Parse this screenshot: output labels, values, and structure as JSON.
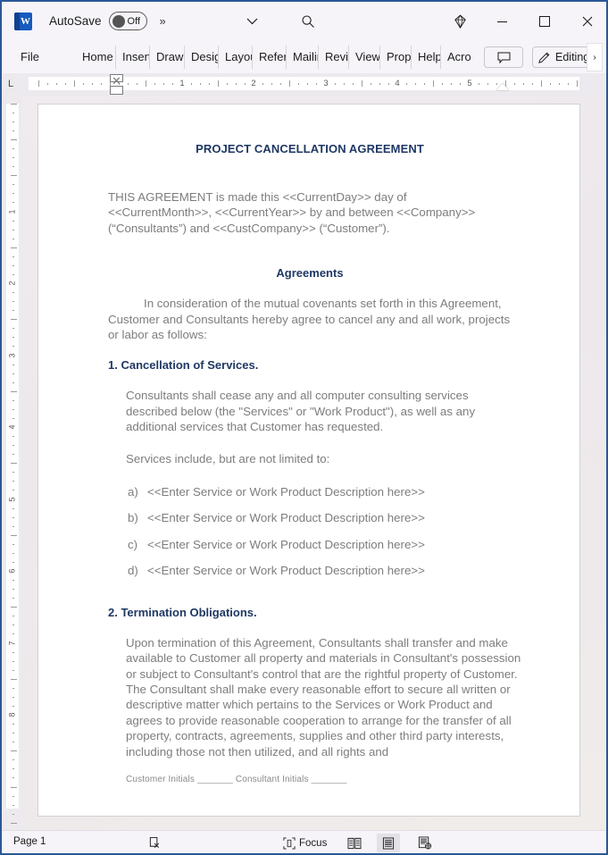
{
  "app": {
    "name": "Microsoft Word",
    "logo_text": "W",
    "accent_color": "#185abd",
    "window_border_color": "#2b5797"
  },
  "titlebar": {
    "autosave_label": "AutoSave",
    "autosave_state": "Off",
    "overflow_chevrons": "»",
    "caret_icon": "chevron-down-icon",
    "search_icon": "search-icon",
    "copilot_icon": "diamond-icon",
    "minimize_label": "–",
    "maximize_label": "□",
    "close_label": "✕"
  },
  "ribbon": {
    "tabs": [
      {
        "label": "File",
        "key": "file"
      },
      {
        "label": "Home",
        "key": "home"
      },
      {
        "label": "Insert",
        "key": "insert"
      },
      {
        "label": "Draw",
        "key": "draw"
      },
      {
        "label": "Design",
        "key": "design"
      },
      {
        "label": "Layout",
        "key": "layout"
      },
      {
        "label": "References",
        "key": "references"
      },
      {
        "label": "Mailings",
        "key": "mailings"
      },
      {
        "label": "Review",
        "key": "review"
      },
      {
        "label": "View",
        "key": "view"
      },
      {
        "label": "Properties",
        "key": "properties"
      },
      {
        "label": "Help",
        "key": "help"
      },
      {
        "label": "Acrobat",
        "key": "acrobat"
      }
    ],
    "comment_icon": "comment-icon",
    "editing_label": "Editing",
    "editing_icon": "pencil-icon",
    "more_label": "›"
  },
  "ruler": {
    "tab_stop_marker": "L",
    "horizontal_numbers": [
      "1",
      "2",
      "3",
      "4",
      "5"
    ],
    "vertical_numbers": [
      "1",
      "2",
      "3",
      "4",
      "5",
      "6",
      "7",
      "8"
    ],
    "first_line_indent_icon": "first-line-indent-marker",
    "hanging_indent_icon": "hanging-indent-marker",
    "right_indent_icon": "right-indent-marker"
  },
  "document": {
    "title": "PROJECT CANCELLATION AGREEMENT",
    "intro": "THIS AGREEMENT is made this <<CurrentDay>> day of <<CurrentMonth>>, <<CurrentYear>> by and between <<Company>> (“Consultants”) and <<CustCompany>> (“Customer”).",
    "agreements_heading": "Agreements",
    "consideration": "In consideration of the mutual covenants set forth in this Agreement, Customer and Consultants hereby agree to cancel any and all work, projects or labor as follows:",
    "section1_heading": "1. Cancellation of Services.",
    "section1_p1": "Consultants shall cease any and all computer consulting services described below (the \"Services\" or \"Work Product\"), as well as any additional services that Customer has requested.",
    "section1_p2": "Services include, but are not limited to:",
    "service_items": [
      {
        "marker": "a)",
        "text": "<<Enter Service or Work Product Description here>>"
      },
      {
        "marker": "b)",
        "text": "<<Enter Service or Work Product Description here>>"
      },
      {
        "marker": "c)",
        "text": "<<Enter Service or Work Product Description here>>"
      },
      {
        "marker": "d)",
        "text": "<<Enter Service or Work Product Description here>>"
      }
    ],
    "section2_heading": "2. Termination Obligations.",
    "section2_p1": "Upon termination of this Agreement, Consultants shall transfer and make available to Customer all property and materials in Consultant's possession or subject to Consultant's control that are the rightful property of Customer.  The Consultant shall make every reasonable effort to secure all written or descriptive matter which pertains to the Services or Work Product and agrees to provide reasonable cooperation to arrange for the transfer of all property, contracts, agreements, supplies and other third party interests, including those not then utilized, and all rights and",
    "footer_initials": "Customer Initials  _______ Consultant Initials _______",
    "title_color": "#1f3864",
    "body_color": "#7d7d7d"
  },
  "statusbar": {
    "page_label": "Page 1",
    "proofing_icon": "spelling-check-icon",
    "focus_label": "Focus",
    "focus_icon": "focus-icon",
    "read_mode_icon": "read-mode-icon",
    "print_layout_icon": "print-layout-icon",
    "web_layout_icon": "web-layout-icon"
  }
}
